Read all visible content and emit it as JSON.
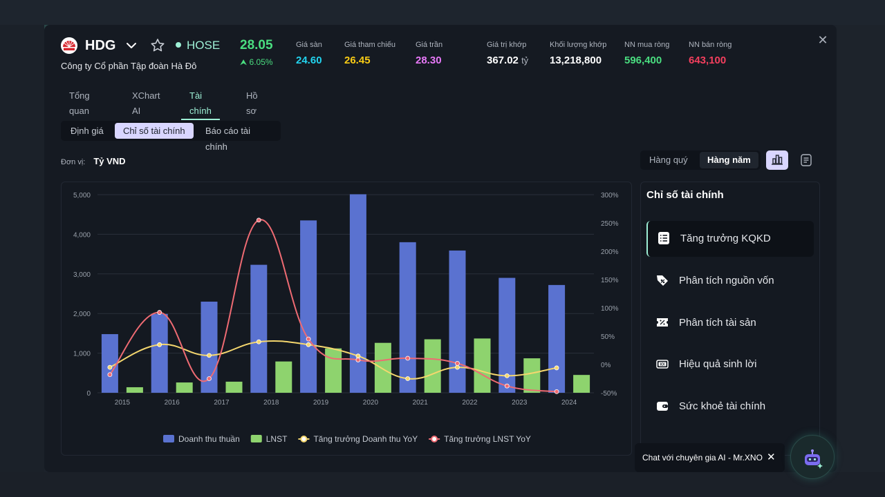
{
  "header": {
    "ticker": "HDG",
    "exchange": "HOSE",
    "company": "Công ty Cổ phần Tập đoàn Hà Đô",
    "price": "28.05",
    "change": "6.05%",
    "stats": [
      {
        "label": "Giá sàn",
        "value": "24.60",
        "color": "#22d3ee"
      },
      {
        "label": "Giá tham chiếu",
        "value": "26.45",
        "color": "#facc15"
      },
      {
        "label": "Giá trần",
        "value": "28.30",
        "color": "#e879f9"
      },
      {
        "label": "Giá trị khớp",
        "value": "367.02",
        "unit": "tỷ",
        "color": "#ffffff"
      },
      {
        "label": "Khối lượng khớp",
        "value": "13,218,800",
        "color": "#ffffff"
      },
      {
        "label": "NN mua ròng",
        "value": "596,400",
        "color": "#4ade80"
      },
      {
        "label": "NN bán ròng",
        "value": "643,100",
        "color": "#f43f5e"
      }
    ]
  },
  "tabs": [
    "Tổng quan",
    "XChart AI",
    "Tài chính",
    "Hồ sơ"
  ],
  "subtabs": [
    "Định giá",
    "Chỉ số tài chính",
    "Báo cáo tài chính"
  ],
  "unit": {
    "label": "Đơn vị:",
    "value": "Tỷ VND"
  },
  "period": {
    "quarter": "Hàng quý",
    "year": "Hàng năm"
  },
  "side": {
    "title": "Chỉ số tài chính",
    "items": [
      "Tăng trưởng KQKD",
      "Phân tích nguồn vốn",
      "Phân tích tài sản",
      "Hiệu quả sinh lời",
      "Sức khoẻ tài chính"
    ]
  },
  "chat": {
    "label": "Chat với chuyên gia AI - Mr.XNO",
    "close": "✕"
  },
  "close_icon": "✕",
  "chart_data": {
    "type": "bar",
    "categories": [
      "2015",
      "2016",
      "2017",
      "2018",
      "2019",
      "2020",
      "2021",
      "2022",
      "2023",
      "2024"
    ],
    "y_left_ticks": [
      "0",
      "1,000",
      "2,000",
      "3,000",
      "4,000",
      "5,000"
    ],
    "y_right_ticks": [
      "-50%",
      "0%",
      "50%",
      "100%",
      "150%",
      "200%",
      "250%",
      "300%"
    ],
    "ylim_left": [
      0,
      5000
    ],
    "ylim_right": [
      -50,
      300
    ],
    "series": [
      {
        "name": "Doanh thu thuần",
        "kind": "bar",
        "axis": "left",
        "color": "#5a72d0",
        "values": [
          1480,
          1990,
          2300,
          3230,
          4350,
          5010,
          3800,
          3590,
          2900,
          2720
        ]
      },
      {
        "name": "LNST",
        "kind": "bar",
        "axis": "left",
        "color": "#8ed36e",
        "values": [
          140,
          260,
          280,
          790,
          1120,
          1260,
          1350,
          1370,
          870,
          450
        ]
      },
      {
        "name": "Tăng trưởng Doanh thu YoY",
        "kind": "line",
        "axis": "right",
        "color": "#f5d76e",
        "values": [
          -5,
          35,
          16,
          40,
          35,
          15,
          -25,
          -5,
          -20,
          -6
        ]
      },
      {
        "name": "Tăng trưởng LNST YoY",
        "kind": "line",
        "axis": "right",
        "color": "#ef6b73",
        "values": [
          -18,
          92,
          -25,
          255,
          45,
          8,
          11,
          2,
          -38,
          -48
        ]
      }
    ],
    "legend_position": "bottom",
    "grid": true
  }
}
